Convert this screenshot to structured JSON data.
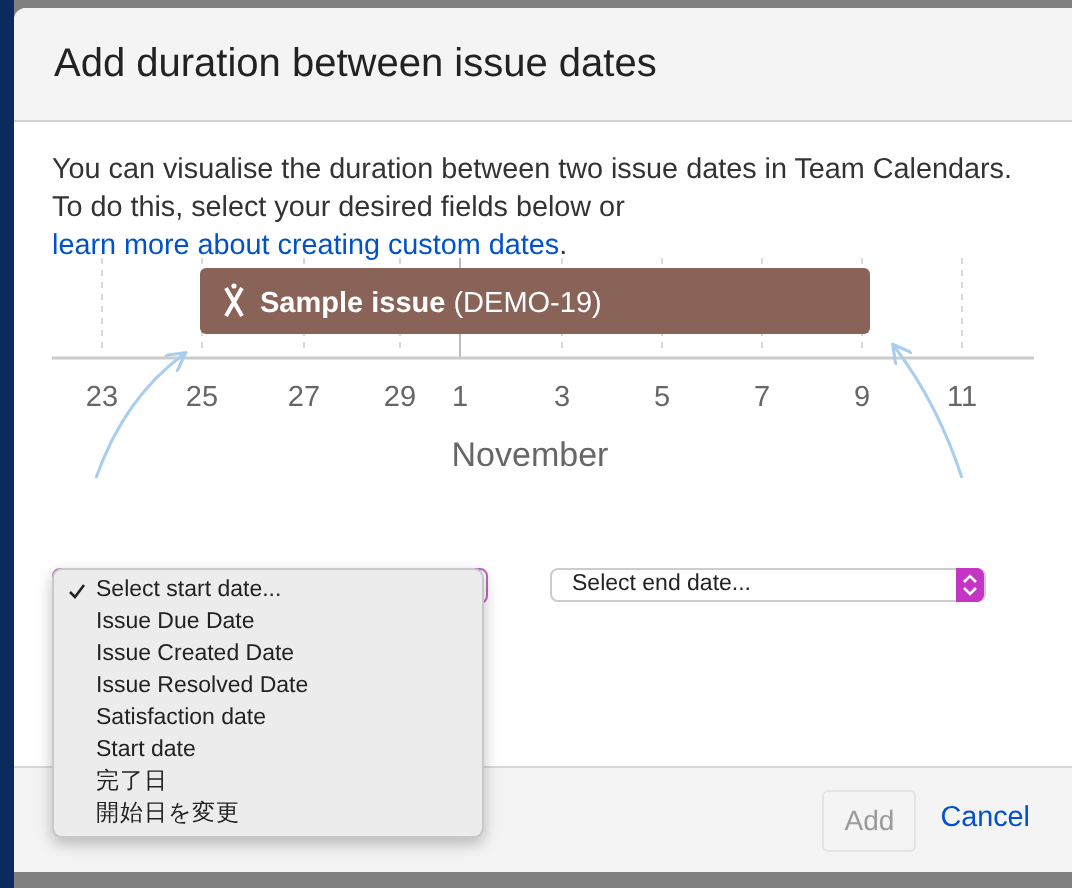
{
  "dialog": {
    "title": "Add duration between issue dates",
    "description": "You can visualise the duration between two issue dates in Team Calendars. To do this, select your desired fields below or ",
    "link": "learn more about creating custom dates",
    "description_end": ".",
    "timeline": {
      "event": "**Sample issue** (DEMO-19)",
      "ticks": [
        "23",
        "25",
        "27",
        "29",
        "1",
        "3",
        "5",
        "7",
        "9",
        "11"
      ],
      "month": "November"
    },
    "start_select": {
      "options": [
        {
          "label": "Select start date...",
          "selected": true
        },
        {
          "label": "Issue Due Date",
          "selected": false
        },
        {
          "label": "Issue Created Date",
          "selected": false
        },
        {
          "label": "Issue Resolved Date",
          "selected": false
        },
        {
          "label": "Satisfaction date",
          "selected": false
        },
        {
          "label": "Start date",
          "selected": false
        },
        {
          "label": "完了日",
          "selected": false
        },
        {
          "label": "開始日を変更",
          "selected": false
        }
      ]
    },
    "end_select": {
      "value": "Select end date..."
    },
    "buttons": [
      {
        "label": "Add",
        "kind": "button",
        "disabled": true
      },
      {
        "label": "Cancel",
        "kind": "link",
        "disabled": false
      }
    ]
  }
}
